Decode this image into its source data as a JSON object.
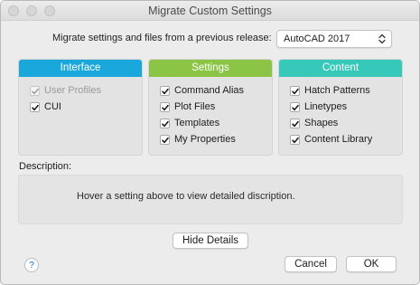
{
  "window": {
    "title": "Migrate Custom Settings"
  },
  "migrate": {
    "label": "Migrate settings and files from a previous release:",
    "selected_release": "AutoCAD 2017"
  },
  "panels": {
    "interface": {
      "header": "Interface",
      "color": "#1aa8dc",
      "options": [
        {
          "label": "User Profiles",
          "checked": true,
          "enabled": false
        },
        {
          "label": "CUI",
          "checked": true,
          "enabled": true
        }
      ]
    },
    "settings": {
      "header": "Settings",
      "color": "#8cc445",
      "options": [
        {
          "label": "Command Alias",
          "checked": true,
          "enabled": true
        },
        {
          "label": "Plot Files",
          "checked": true,
          "enabled": true
        },
        {
          "label": "Templates",
          "checked": true,
          "enabled": true
        },
        {
          "label": "My Properties",
          "checked": true,
          "enabled": true
        }
      ]
    },
    "content": {
      "header": "Content",
      "color": "#36c8b9",
      "options": [
        {
          "label": "Hatch Patterns",
          "checked": true,
          "enabled": true
        },
        {
          "label": "Linetypes",
          "checked": true,
          "enabled": true
        },
        {
          "label": "Shapes",
          "checked": true,
          "enabled": true
        },
        {
          "label": "Content Library",
          "checked": true,
          "enabled": true
        }
      ]
    }
  },
  "description": {
    "label": "Description:",
    "text": "Hover a setting above to view detailed discription."
  },
  "buttons": {
    "hide_details": "Hide Details",
    "cancel": "Cancel",
    "ok": "OK",
    "help": "?"
  },
  "icons": {
    "close": "close-icon",
    "minimize": "minimize-icon",
    "zoom": "zoom-icon",
    "help": "help-icon",
    "select_arrows": "up-down-arrows-icon",
    "checkbox_check": "checkmark-icon"
  }
}
